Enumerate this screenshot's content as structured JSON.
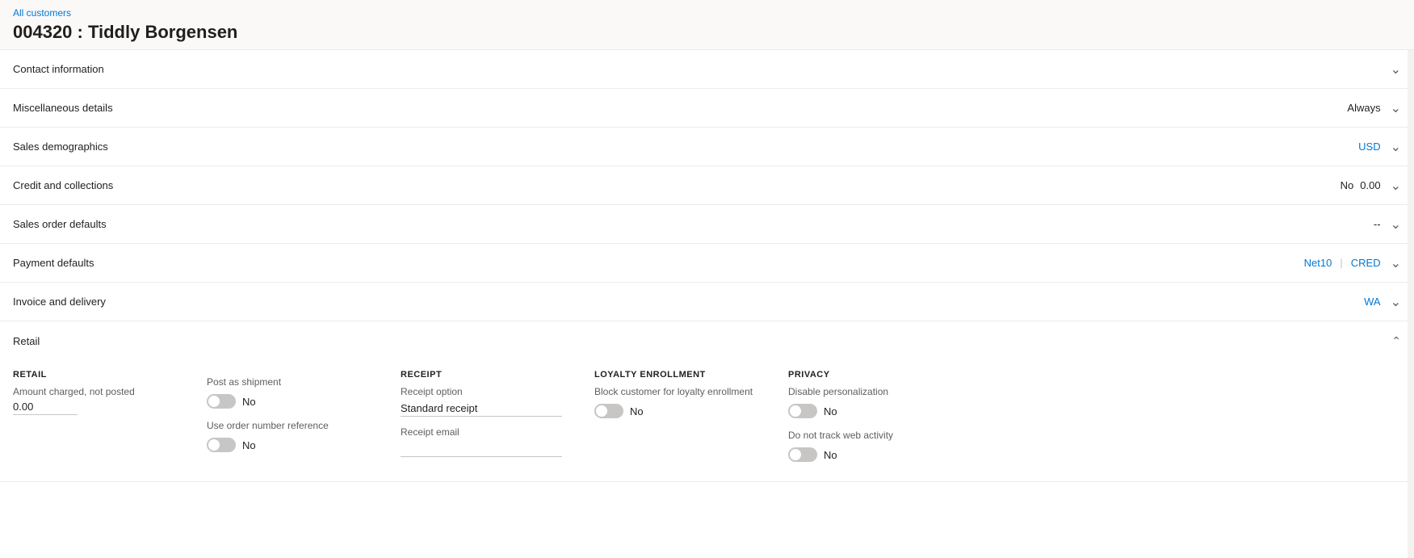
{
  "breadcrumb": {
    "link_text": "All customers"
  },
  "page_title": "004320 : Tiddly Borgensen",
  "sections": [
    {
      "id": "contact-information",
      "title": "Contact information",
      "right_values": [],
      "expanded": false
    },
    {
      "id": "miscellaneous-details",
      "title": "Miscellaneous details",
      "right_values": [
        "Always"
      ],
      "value_color": "normal",
      "expanded": false
    },
    {
      "id": "sales-demographics",
      "title": "Sales demographics",
      "right_values": [
        "USD"
      ],
      "value_color": "blue",
      "expanded": false
    },
    {
      "id": "credit-and-collections",
      "title": "Credit and collections",
      "right_values": [
        "No",
        "0.00"
      ],
      "value_color": "normal",
      "expanded": false
    },
    {
      "id": "sales-order-defaults",
      "title": "Sales order defaults",
      "right_values": [
        "--"
      ],
      "value_color": "normal",
      "expanded": false
    },
    {
      "id": "payment-defaults",
      "title": "Payment defaults",
      "right_values_mixed": [
        {
          "text": "Net10",
          "color": "blue"
        },
        {
          "text": "|",
          "color": "separator"
        },
        {
          "text": "CRED",
          "color": "blue"
        }
      ],
      "expanded": false
    },
    {
      "id": "invoice-and-delivery",
      "title": "Invoice and delivery",
      "right_values": [
        "WA"
      ],
      "value_color": "blue",
      "expanded": false
    }
  ],
  "retail_section": {
    "title": "Retail",
    "expanded": true,
    "retail_col": {
      "label": "RETAIL",
      "amount_label": "Amount charged, not posted",
      "amount_value": "0.00"
    },
    "shipment_col": {
      "post_as_shipment_label": "Post as shipment",
      "post_as_shipment_toggle": false,
      "post_as_shipment_value": "No",
      "use_order_number_label": "Use order number reference",
      "use_order_number_toggle": false,
      "use_order_number_value": "No"
    },
    "receipt_col": {
      "label": "RECEIPT",
      "receipt_option_label": "Receipt option",
      "receipt_option_value": "Standard receipt",
      "receipt_email_label": "Receipt email",
      "receipt_email_value": ""
    },
    "loyalty_col": {
      "label": "LOYALTY ENROLLMENT",
      "block_label": "Block customer for loyalty enrollment",
      "block_toggle": false,
      "block_value": "No"
    },
    "privacy_col": {
      "label": "PRIVACY",
      "disable_personalization_label": "Disable personalization",
      "disable_personalization_toggle": false,
      "disable_personalization_value": "No",
      "do_not_track_label": "Do not track web activity",
      "do_not_track_toggle": false,
      "do_not_track_value": "No"
    }
  }
}
